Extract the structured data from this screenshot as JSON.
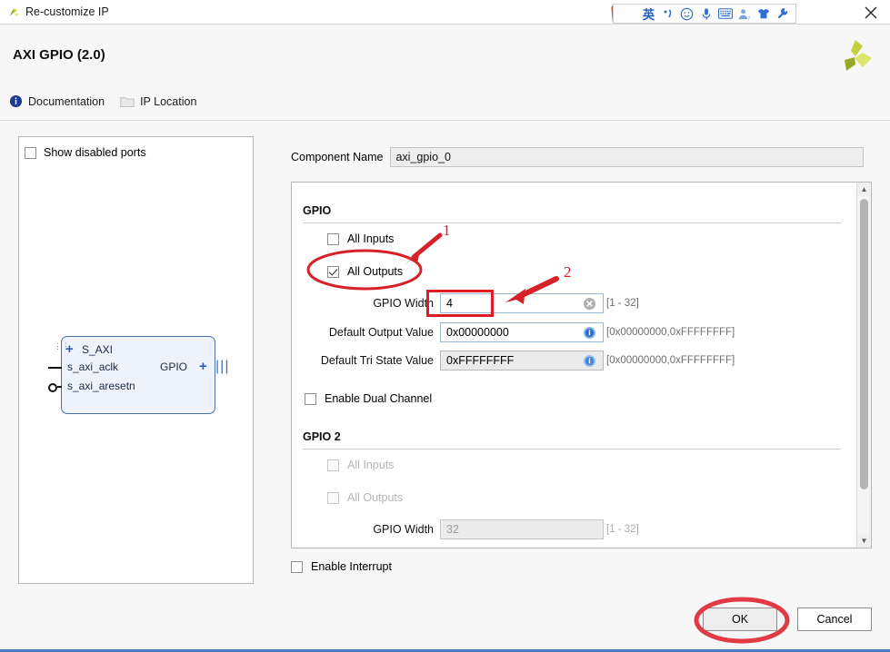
{
  "window": {
    "title": "Re-customize IP",
    "close_label": "Close",
    "logo_name": "vivado-logo"
  },
  "ime": {
    "name": "sogou-input-toolbar",
    "items": [
      {
        "name": "sogou-logo-icon",
        "glyph": "S"
      },
      {
        "name": "language-mode-icon",
        "glyph": "英"
      },
      {
        "name": "punctuation-mode-icon",
        "glyph": "·ʔ"
      },
      {
        "name": "emoji-icon",
        "glyph": "☺"
      },
      {
        "name": "voice-input-icon",
        "glyph": "Ἲ4"
      },
      {
        "name": "soft-keyboard-icon",
        "glyph": "⌨"
      },
      {
        "name": "user-account-icon",
        "glyph": "὆4"
      },
      {
        "name": "skin-icon",
        "glyph": "ὅ5"
      },
      {
        "name": "settings-wrench-icon",
        "glyph": "ὒ7"
      }
    ]
  },
  "header": {
    "ip_title": "AXI GPIO (2.0)",
    "brand_logo_name": "xilinx-pinwheel-logo",
    "links": [
      {
        "name": "documentation-link",
        "label": "Documentation",
        "icon": "info-icon"
      },
      {
        "name": "ip-location-link",
        "label": "IP Location",
        "icon": "folder-icon"
      }
    ]
  },
  "port_panel": {
    "show_disabled_ports": {
      "label": "Show disabled ports",
      "checked": false
    },
    "block": {
      "bus_port": "S_AXI",
      "pins": [
        "s_axi_aclk",
        "s_axi_aresetn"
      ],
      "out_port": "GPIO"
    }
  },
  "component": {
    "label": "Component Name",
    "value": "axi_gpio_0"
  },
  "gpio": {
    "section_title": "GPIO",
    "all_inputs": {
      "label": "All Inputs",
      "checked": false,
      "disabled": false
    },
    "all_outputs": {
      "label": "All Outputs",
      "checked": true,
      "disabled": false
    },
    "width": {
      "label": "GPIO Width",
      "value": "4",
      "range": "[1 - 32]",
      "focused": true
    },
    "default_output": {
      "label": "Default Output Value",
      "value": "0x00000000",
      "range": "[0x00000000,0xFFFFFFFF]"
    },
    "default_tristate": {
      "label": "Default Tri State Value",
      "value": "0xFFFFFFFF",
      "range": "[0x00000000,0xFFFFFFFF]"
    },
    "enable_dual_channel": {
      "label": "Enable Dual Channel",
      "checked": false
    }
  },
  "gpio2": {
    "section_title": "GPIO 2",
    "all_inputs": {
      "label": "All Inputs",
      "checked": false,
      "disabled": true
    },
    "all_outputs": {
      "label": "All Outputs",
      "checked": false,
      "disabled": true
    },
    "width": {
      "label": "GPIO Width",
      "value": "32",
      "range": "[1 - 32]",
      "disabled": true
    }
  },
  "footer": {
    "enable_interrupt": {
      "label": "Enable Interrupt",
      "checked": false
    },
    "ok_label": "OK",
    "cancel_label": "Cancel"
  },
  "annotations": {
    "color": "#d62128",
    "marker_1": "1",
    "marker_2": "2",
    "ellipse_all_outputs": "highlight-all-outputs",
    "rect_gpio_width": "highlight-gpio-width",
    "ellipse_ok": "highlight-ok-button"
  }
}
